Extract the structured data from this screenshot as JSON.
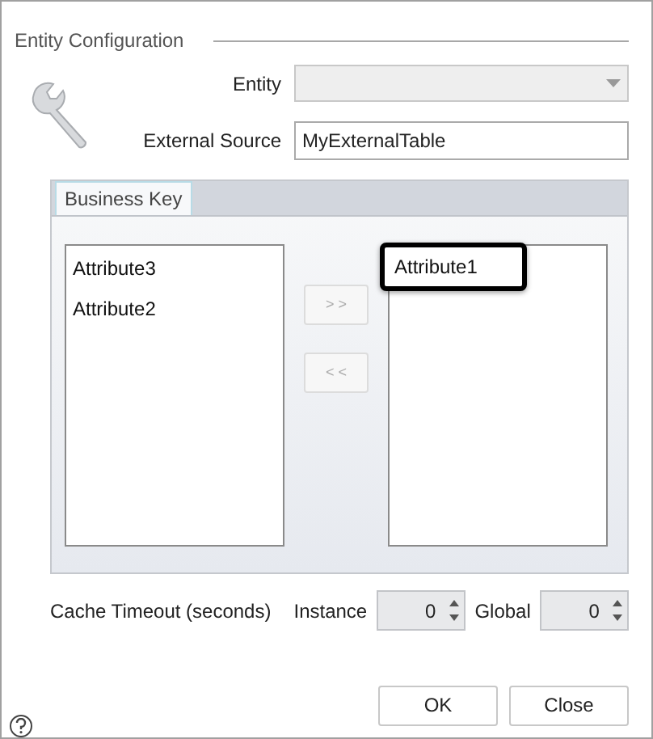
{
  "group": {
    "title": "Entity Configuration"
  },
  "entity": {
    "label": "Entity",
    "disabled": true
  },
  "external_source": {
    "label": "External Source",
    "value": "MyExternalTable"
  },
  "tabs": [
    {
      "label": "Business Key",
      "selected": true
    }
  ],
  "available": [
    {
      "label": "Attribute3",
      "highlighted": false
    },
    {
      "label": "Attribute2",
      "highlighted": false
    }
  ],
  "move_buttons": [
    {
      "label": "> >",
      "disabled": true
    },
    {
      "label": "< <",
      "disabled": true
    }
  ],
  "chosen": [
    {
      "label": "Attribute1",
      "highlighted": true
    }
  ],
  "cache": {
    "label": "Cache Timeout (seconds)",
    "instance_label": "Instance",
    "instance_value": "0",
    "global_label": "Global",
    "global_value": "0"
  },
  "buttons": [
    "OK",
    "Close"
  ]
}
